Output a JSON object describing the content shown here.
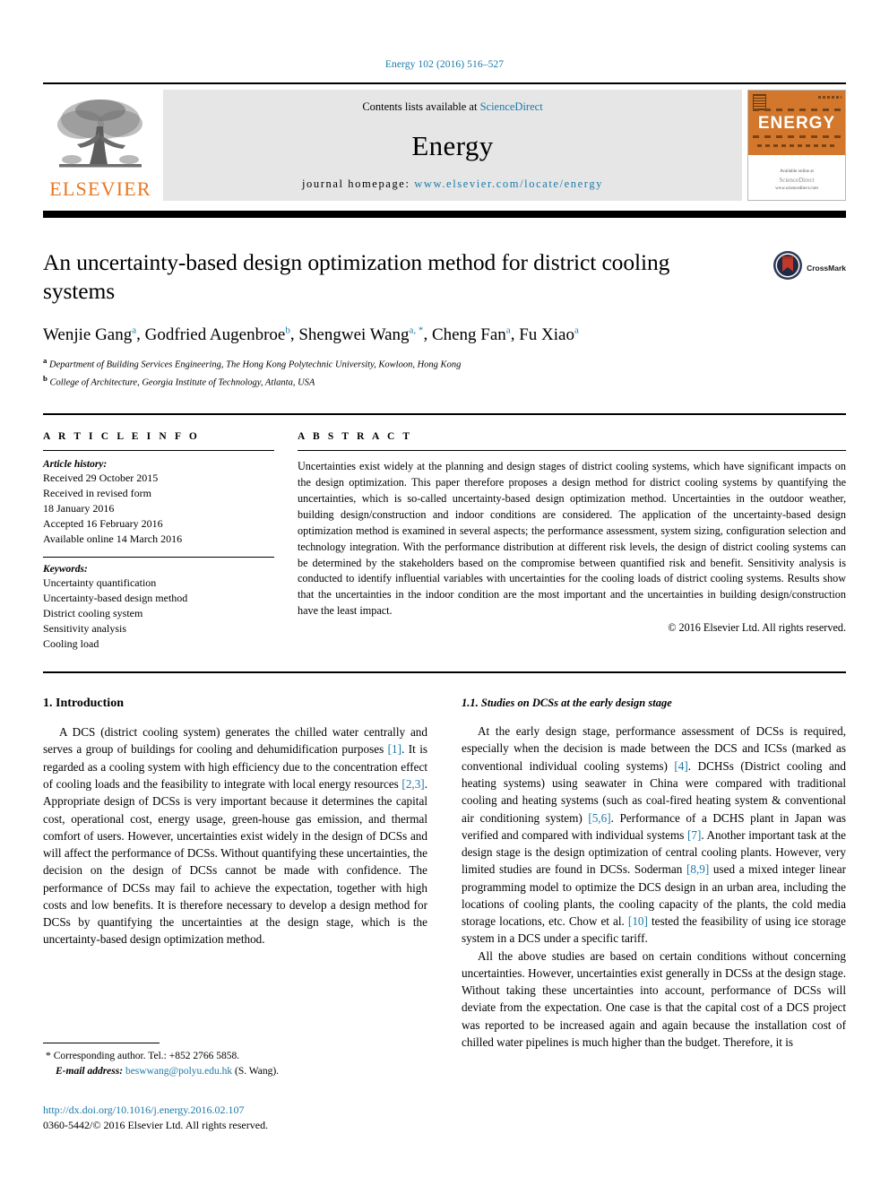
{
  "running_head": "Energy 102 (2016) 516–527",
  "masthead": {
    "publisher_name": "ELSEVIER",
    "contents_prefix": "Contents lists available at ",
    "contents_link": "ScienceDirect",
    "journal_name": "Energy",
    "homepage_prefix": "journal homepage: ",
    "homepage_url": "www.elsevier.com/locate/energy",
    "cover_title": "ENERGY",
    "cover_footer_line1": "Available online at",
    "cover_footer_line2": "ScienceDirect",
    "cover_footer_line3": "www.sciencedirect.com"
  },
  "article": {
    "title": "An uncertainty-based design optimization method for district cooling systems",
    "crossmark_label": "CrossMark",
    "authors": [
      {
        "name": "Wenjie Gang",
        "marks": "a"
      },
      {
        "name": "Godfried Augenbroe",
        "marks": "b"
      },
      {
        "name": "Shengwei Wang",
        "marks": "a, *"
      },
      {
        "name": "Cheng Fan",
        "marks": "a"
      },
      {
        "name": "Fu Xiao",
        "marks": "a"
      }
    ],
    "affiliations": [
      {
        "mark": "a",
        "text": "Department of Building Services Engineering, The Hong Kong Polytechnic University, Kowloon, Hong Kong"
      },
      {
        "mark": "b",
        "text": "College of Architecture, Georgia Institute of Technology, Atlanta, USA"
      }
    ]
  },
  "article_info": {
    "heading": "A R T I C L E   I N F O",
    "history_title": "Article history:",
    "history_lines": [
      "Received 29 October 2015",
      "Received in revised form",
      "18 January 2016",
      "Accepted 16 February 2016",
      "Available online 14 March 2016"
    ],
    "keywords_title": "Keywords:",
    "keywords": [
      "Uncertainty quantification",
      "Uncertainty-based design method",
      "District cooling system",
      "Sensitivity analysis",
      "Cooling load"
    ]
  },
  "abstract": {
    "heading": "A B S T R A C T",
    "text": "Uncertainties exist widely at the planning and design stages of district cooling systems, which have significant impacts on the design optimization. This paper therefore proposes a design method for district cooling systems by quantifying the uncertainties, which is so-called uncertainty-based design optimization method. Uncertainties in the outdoor weather, building design/construction and indoor conditions are considered. The application of the uncertainty-based design optimization method is examined in several aspects; the performance assessment, system sizing, configuration selection and technology integration. With the performance distribution at different risk levels, the design of district cooling systems can be determined by the stakeholders based on the compromise between quantified risk and benefit. Sensitivity analysis is conducted to identify influential variables with uncertainties for the cooling loads of district cooling systems. Results show that the uncertainties in the indoor condition are the most important and the uncertainties in building design/construction have the least impact.",
    "copyright": "© 2016 Elsevier Ltd. All rights reserved."
  },
  "body": {
    "left": {
      "section_heading": "1. Introduction",
      "paragraph_1_a": "A DCS (district cooling system) generates the chilled water centrally and serves a group of buildings for cooling and dehumidification purposes ",
      "ref_1": "[1]",
      "paragraph_1_b": ". It is regarded as a cooling system with high efficiency due to the concentration effect of cooling loads and the feasibility to integrate with local energy resources ",
      "ref_2": "[2,3]",
      "paragraph_1_c": ". Appropriate design of DCSs is very important because it determines the capital cost, operational cost, energy usage, green-house gas emission, and thermal comfort of users. However, uncertainties exist widely in the design of DCSs and will affect the performance of DCSs. Without quantifying these uncertainties, the decision on the design of DCSs cannot be made with confidence. The performance of DCSs may fail to achieve the expectation, together with high costs and low benefits. It is therefore necessary to develop a design method for DCSs by quantifying the uncertainties at the design stage, which is the uncertainty-based design optimization method."
    },
    "right": {
      "subsection_heading": "1.1. Studies on DCSs at the early design stage",
      "paragraph_1_a": "At the early design stage, performance assessment of DCSs is required, especially when the decision is made between the DCS and ICSs (marked as conventional individual cooling systems) ",
      "ref_4": "[4]",
      "paragraph_1_b": ". DCHSs (District cooling and heating systems) using seawater in China were compared with traditional cooling and heating systems (such as coal-fired heating system & conventional air conditioning system) ",
      "ref_56": "[5,6]",
      "paragraph_1_c": ". Performance of a DCHS plant in Japan was verified and compared with individual systems ",
      "ref_7": "[7]",
      "paragraph_1_d": ". Another important task at the design stage is the design optimization of central cooling plants. However, very limited studies are found in DCSs. Soderman ",
      "ref_89": "[8,9]",
      "paragraph_1_e": " used a mixed integer linear programming model to optimize the DCS design in an urban area, including the locations of cooling plants, the cooling capacity of the plants, the cold media storage locations, etc. Chow et al. ",
      "ref_10": "[10]",
      "paragraph_1_f": " tested the feasibility of using ice storage system in a DCS under a specific tariff.",
      "paragraph_2": "All the above studies are based on certain conditions without concerning uncertainties. However, uncertainties exist generally in DCSs at the design stage. Without taking these uncertainties into account, performance of DCSs will deviate from the expectation. One case is that the capital cost of a DCS project was reported to be increased again and again because the installation cost of chilled water pipelines is much higher than the budget. Therefore, it is"
    }
  },
  "footnote": {
    "corresponding_star": "*",
    "corresponding_text": "Corresponding author. Tel.: +852 2766 5858.",
    "email_label": "E-mail address:",
    "email": "beswwang@polyu.edu.hk",
    "email_owner": "(S. Wang)."
  },
  "footer": {
    "doi": "http://dx.doi.org/10.1016/j.energy.2016.02.107",
    "issn_line": "0360-5442/© 2016 Elsevier Ltd. All rights reserved."
  },
  "colors": {
    "link": "#1a7aa8",
    "elsevier_orange": "#E87722",
    "cover_orange": "#D2772B"
  }
}
